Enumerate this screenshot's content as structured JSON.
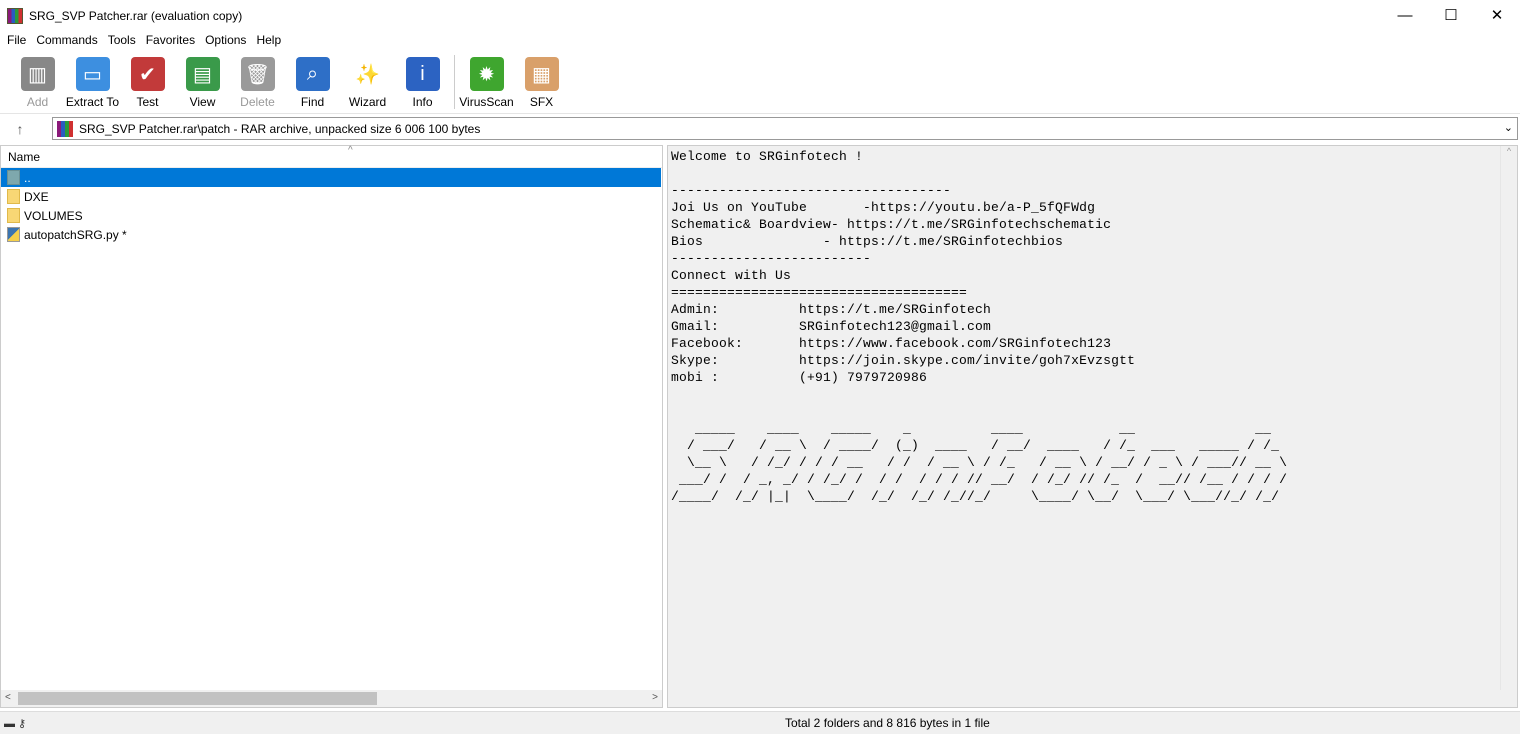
{
  "window": {
    "title": "SRG_SVP Patcher.rar (evaluation copy)",
    "minimize": "—",
    "maximize": "☐",
    "close": "✕"
  },
  "menu": [
    "File",
    "Commands",
    "Tools",
    "Favorites",
    "Options",
    "Help"
  ],
  "toolbar": [
    {
      "label": "Add",
      "icon": "add-icon",
      "color": "#888888",
      "glyph": "▥",
      "disabled": true
    },
    {
      "label": "Extract To",
      "icon": "folder-extract-icon",
      "color": "#3d8fe0",
      "glyph": "▭"
    },
    {
      "label": "Test",
      "icon": "clipboard-check-icon",
      "color": "#c23a3a",
      "glyph": "✔"
    },
    {
      "label": "View",
      "icon": "book-icon",
      "color": "#3a9a4a",
      "glyph": "▤"
    },
    {
      "label": "Delete",
      "icon": "trash-icon",
      "color": "#9a9a9a",
      "glyph": "🗑",
      "disabled": true
    },
    {
      "label": "Find",
      "icon": "magnifier-icon",
      "color": "#2e6fc7",
      "glyph": "⌕"
    },
    {
      "label": "Wizard",
      "icon": "magic-wand-icon",
      "color": "#ffffff",
      "glyph": "✨"
    },
    {
      "label": "Info",
      "icon": "info-icon",
      "color": "#2c63c2",
      "glyph": "i"
    },
    {
      "label": "VirusScan",
      "icon": "virus-scan-icon",
      "color": "#3fa62f",
      "glyph": "✹"
    },
    {
      "label": "SFX",
      "icon": "sfx-box-icon",
      "color": "#d9a06a",
      "glyph": "▦"
    }
  ],
  "address": {
    "path": "SRG_SVP Patcher.rar\\patch - RAR archive, unpacked size 6 006 100 bytes"
  },
  "filelist": {
    "column": "Name",
    "rows": [
      {
        "name": "..",
        "type": "up",
        "selected": true
      },
      {
        "name": "DXE",
        "type": "folder"
      },
      {
        "name": "VOLUMES",
        "type": "folder"
      },
      {
        "name": "autopatchSRG.py *",
        "type": "py"
      }
    ]
  },
  "comment": {
    "lines": [
      "Welcome to SRGinfotech !",
      "",
      "-----------------------------------",
      "Joi Us on YouTube       -https://youtu.be/a-P_5fQFWdg",
      "Schematic& Boardview- https://t.me/SRGinfotechschematic",
      "Bios               - https://t.me/SRGinfotechbios",
      "-------------------------",
      "Connect with Us",
      "=====================================",
      "Admin:          https://t.me/SRGinfotech",
      "Gmail:          SRGinfotech123@gmail.com",
      "Facebook:       https://www.facebook.com/SRGinfotech123",
      "Skype:          https://join.skype.com/invite/goh7xEvzsgtt",
      "mobi :          (+91) 7979720986",
      "",
      "",
      "   _____    ____    _____    _          ____            __               __",
      "  / ___/   / __ \\  / ____/  (_)  ____   / __/  ____   / /_  ___   _____ / /_",
      "  \\__ \\   / /_/ / / / __   / /  / __ \\ / /_   / __ \\ / __/ / _ \\ / ___// __ \\",
      " ___/ /  / _, _/ / /_/ /  / /  / / / // __/  / /_/ // /_  /  __// /__ / / / /",
      "/____/  /_/ |_|  \\____/  /_/  /_/ /_//_/     \\____/ \\__/  \\___/ \\___//_/ /_/"
    ]
  },
  "status": {
    "text": "Total 2 folders and 8 816 bytes in 1 file"
  }
}
